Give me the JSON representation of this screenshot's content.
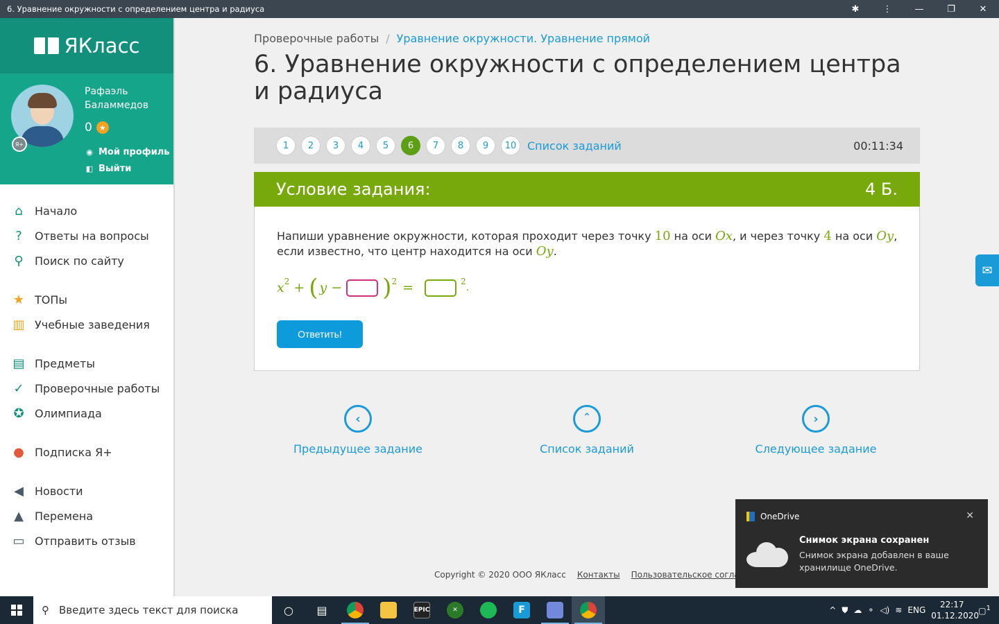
{
  "window": {
    "title": "6. Уравнение окружности с определением центра и радиуса",
    "controls": [
      "—",
      "❐",
      "✕"
    ]
  },
  "sidebar": {
    "logo": "ЯКласс",
    "user": {
      "name": "Рафаэль Баламмедов",
      "score": "0",
      "badge": "Я+",
      "profile_link": "Мой профиль",
      "logout_link": "Выйти"
    },
    "menu": [
      {
        "label": "Начало",
        "icon": "home-icon"
      },
      {
        "label": "Ответы на вопросы",
        "icon": "question-icon"
      },
      {
        "label": "Поиск по сайту",
        "icon": "search-icon"
      },
      {
        "label": "ТОПы",
        "icon": "star-icon"
      },
      {
        "label": "Учебные заведения",
        "icon": "institution-icon"
      },
      {
        "label": "Предметы",
        "icon": "book-icon"
      },
      {
        "label": "Проверочные работы",
        "icon": "check-circle-icon"
      },
      {
        "label": "Олимпиада",
        "icon": "medal-icon"
      },
      {
        "label": "Подписка Я+",
        "icon": "subscription-icon"
      },
      {
        "label": "Новости",
        "icon": "megaphone-icon"
      },
      {
        "label": "Перемена",
        "icon": "bell-icon"
      },
      {
        "label": "Отправить отзыв",
        "icon": "feedback-icon"
      }
    ]
  },
  "breadcrumb": {
    "root": "Проверочные работы",
    "separator": "/",
    "current": "Уравнение окружности. Уравнение прямой"
  },
  "page_title": "6. Уравнение окружности с определением центра и радиуса",
  "task_nav": {
    "numbers": [
      "1",
      "2",
      "3",
      "4",
      "5",
      "6",
      "7",
      "8",
      "9",
      "10"
    ],
    "active": "6",
    "list_link": "Список заданий",
    "timer": "00:11:34"
  },
  "condition": {
    "header": "Условие задания:",
    "points": "4 Б.",
    "text_parts": {
      "p1": "Напиши уравнение окружности, которая проходит через точку ",
      "n1": "10",
      "p2": " на оси ",
      "ax1": "Ox",
      "p3": ", и через точку ",
      "n2": "4",
      "p4": " на оси ",
      "ax2": "Oy",
      "p5": ", если известно, что центр находится на оси ",
      "ax3": "Oy",
      "p6": "."
    },
    "formula": {
      "x": "x",
      "exp": "2",
      "plus": "+",
      "open": "(",
      "y": "y",
      "minus": "−",
      "close": ")",
      "exp2": "2",
      "eq": "=",
      "exp3": "2",
      "end": "."
    },
    "answer_button": "Ответить!"
  },
  "bottom_nav": {
    "prev": "Предыдущее задание",
    "list": "Список заданий",
    "next": "Следующее задание"
  },
  "footer": {
    "copyright": "Copyright © 2020 ООО ЯКласс",
    "contacts": "Контакты",
    "agreement": "Пользовательское соглашени"
  },
  "toast": {
    "app": "OneDrive",
    "title": "Снимок экрана сохранен",
    "body": "Снимок экрана добавлен в ваше хранилище OneDrive."
  },
  "taskbar": {
    "search_placeholder": "Введите здесь текст для поиска",
    "apps": [
      "cortana-icon",
      "task-view-icon",
      "chrome-icon",
      "explorer-icon",
      "epic-games-icon",
      "xbox-icon",
      "spotify-icon",
      "app-f-icon",
      "discord-icon",
      "chrome-active-icon"
    ],
    "epic_label": "EPIC",
    "f_label": "F",
    "lang": "ENG",
    "time": "22:17",
    "date": "01.12.2020",
    "notif_count": "1"
  },
  "colors": {
    "brand_green": "#12907b",
    "condition_green": "#77a80c",
    "link_blue": "#1a9bd7"
  }
}
